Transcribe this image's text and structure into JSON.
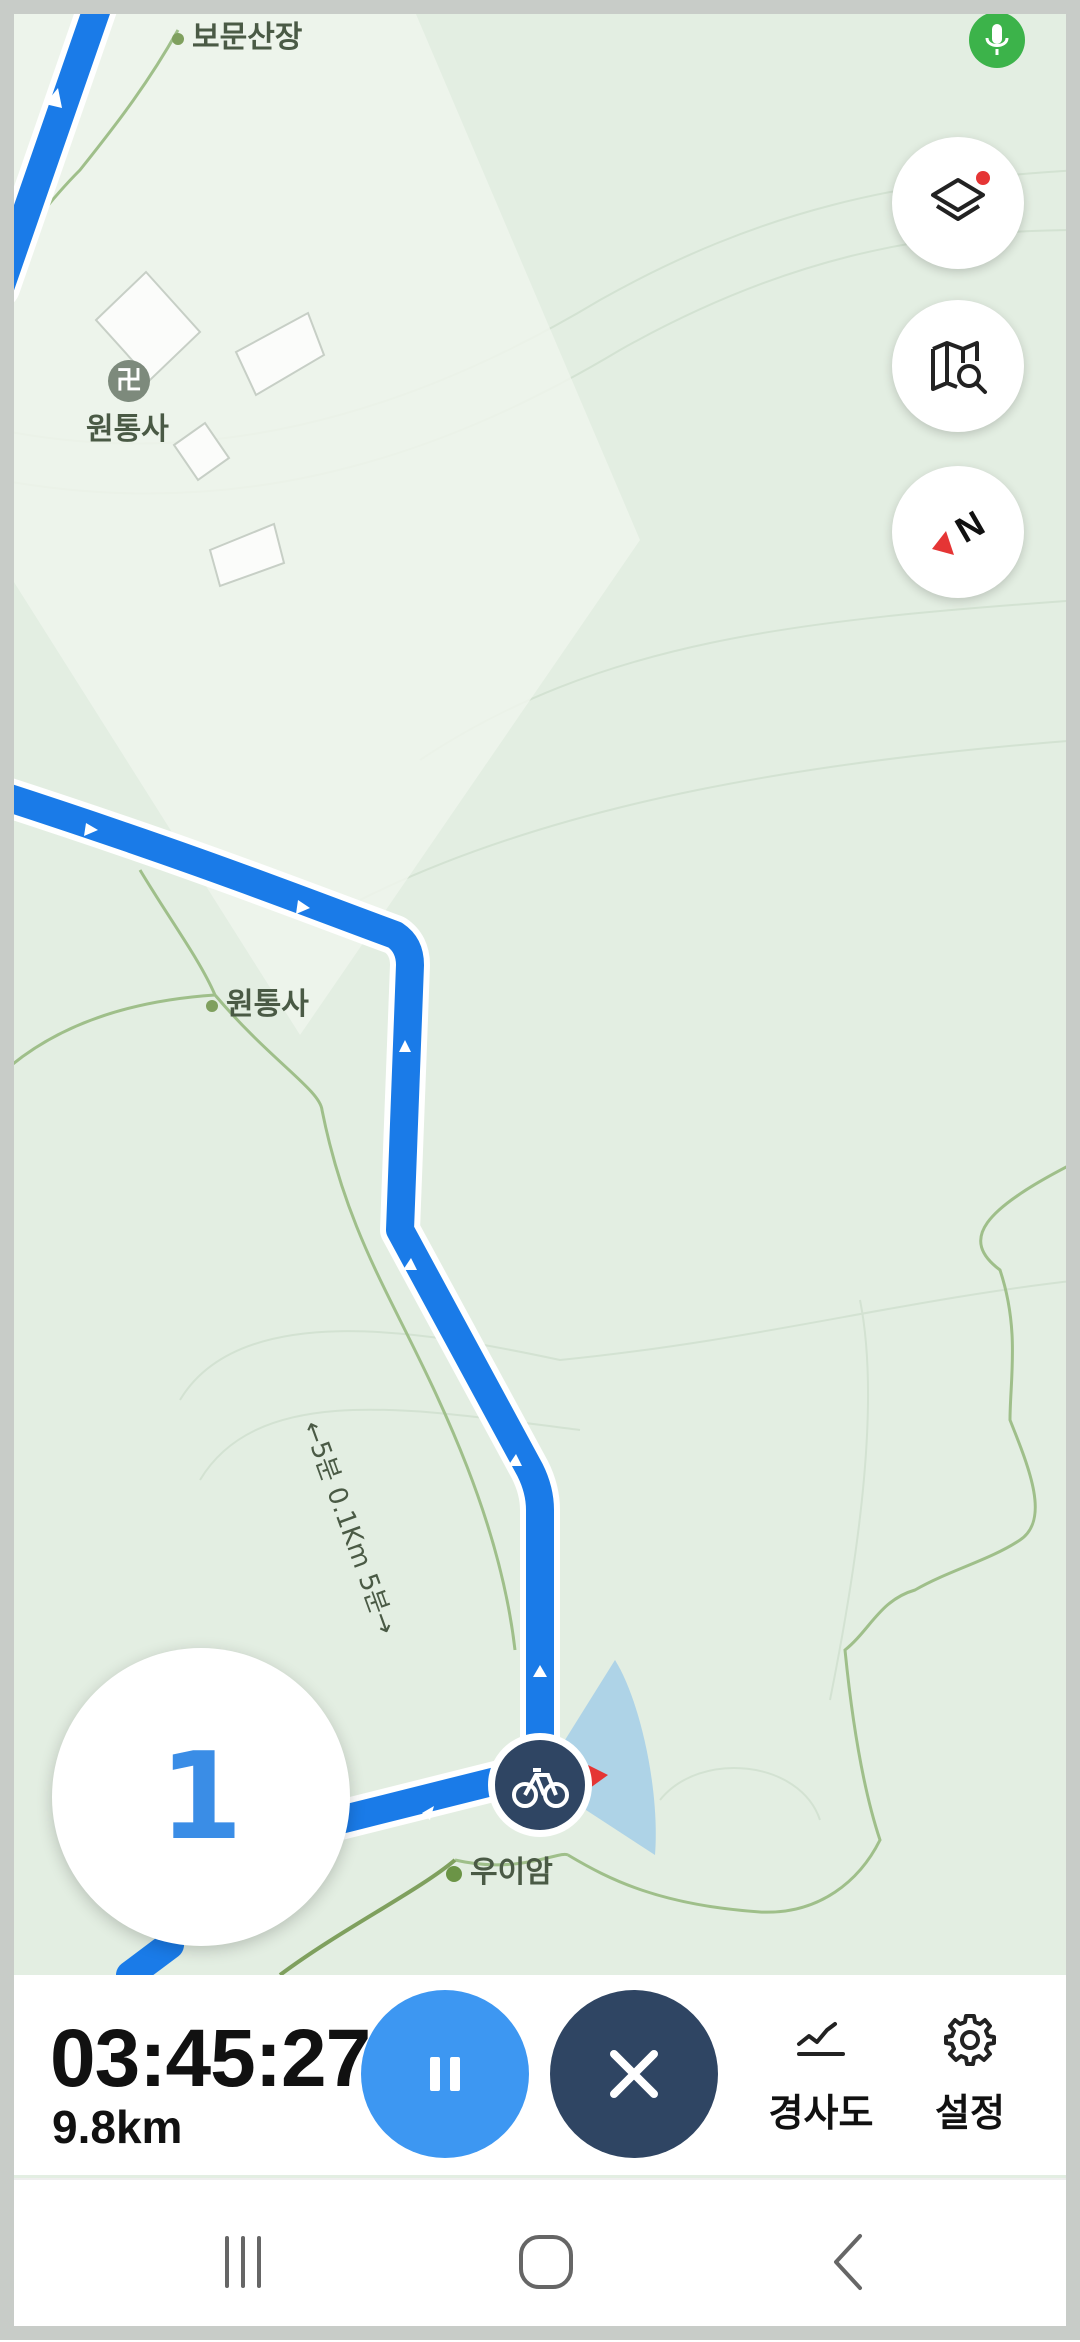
{
  "map": {
    "places": [
      {
        "name": "보문산장"
      },
      {
        "name": "원통사"
      },
      {
        "name": "원통사"
      },
      {
        "name": "우이암"
      }
    ],
    "trail_label": "←5분 0.1Km 5분→"
  },
  "controls": {
    "layers_icon": "layers-icon",
    "map_search_icon": "map-search-icon",
    "compass_label": "N",
    "mic_icon": "microphone-icon"
  },
  "turn": {
    "number": "1"
  },
  "stats": {
    "elapsed": "03:45:27",
    "distance": "9.8km"
  },
  "tools": {
    "slope_label": "경사도",
    "settings_label": "설정"
  },
  "colors": {
    "route": "#1a7be8",
    "pause": "#3d97f2",
    "close": "#2f4563",
    "mic": "#3cb34a"
  }
}
